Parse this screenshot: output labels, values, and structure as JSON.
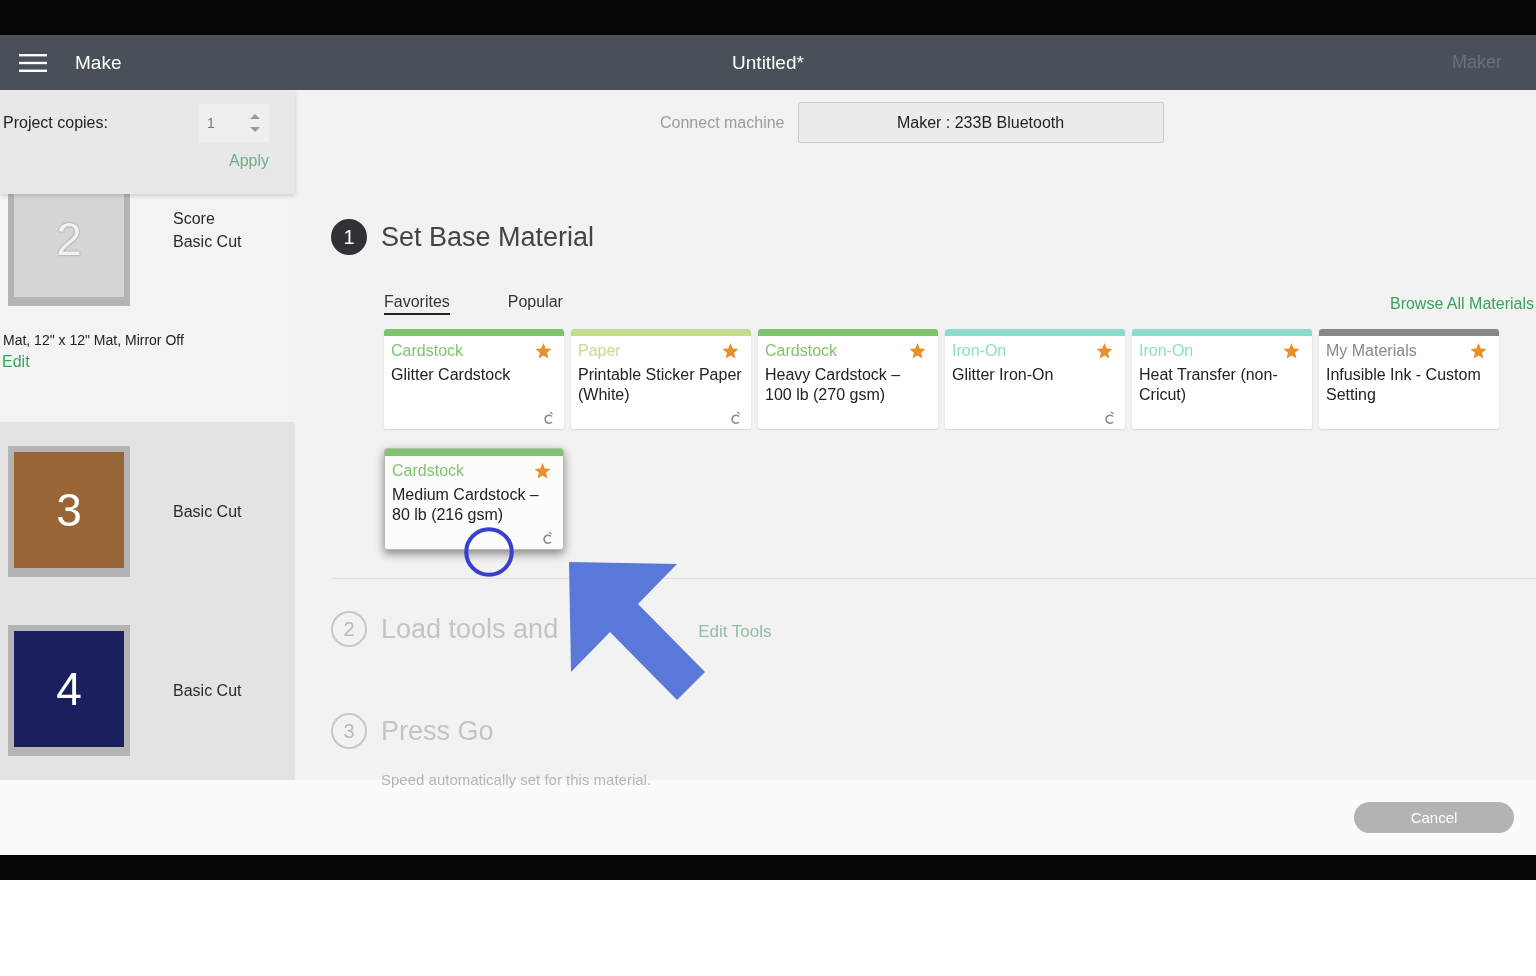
{
  "header": {
    "menu_label": "Make",
    "title": "Untitled*",
    "machine": "Maker"
  },
  "sidebar": {
    "copies": {
      "label": "Project copies:",
      "value": "1",
      "apply": "Apply"
    },
    "mats": [
      {
        "number": "2",
        "lines": [
          "Score",
          "Basic Cut"
        ],
        "selected": true,
        "kind": "gray",
        "info": "Mat, 12\" x 12\" Mat, Mirror Off",
        "edit": "Edit"
      },
      {
        "number": "3",
        "lines": [
          "Basic Cut"
        ],
        "selected": false,
        "kind": "brown"
      },
      {
        "number": "4",
        "lines": [
          "Basic Cut"
        ],
        "selected": false,
        "kind": "navy"
      }
    ]
  },
  "connect": {
    "label": "Connect machine",
    "button": "Maker : 233B Bluetooth"
  },
  "steps": [
    {
      "number": "1",
      "title": "Set Base Material",
      "active": true
    },
    {
      "number": "2",
      "title": "Load tools and",
      "active": false,
      "link": "Edit Tools"
    },
    {
      "number": "3",
      "title": "Press Go",
      "active": false,
      "note": "Speed automatically set for this material."
    }
  ],
  "material_tabs": [
    {
      "label": "Favorites",
      "selected": true
    },
    {
      "label": "Popular",
      "selected": false
    }
  ],
  "browse_link": "Browse All Materials",
  "materials": [
    {
      "category": "Cardstock",
      "name": "Glitter Cardstock",
      "color": "#7fc46c",
      "favorite": true,
      "cricut": true,
      "selected": false
    },
    {
      "category": "Paper",
      "name": "Printable Sticker Paper (White)",
      "color": "#c3dd8e",
      "favorite": true,
      "cricut": true,
      "selected": false
    },
    {
      "category": "Cardstock",
      "name": "Heavy Cardstock – 100 lb (270 gsm)",
      "color": "#7fc46c",
      "favorite": true,
      "cricut": false,
      "selected": false
    },
    {
      "category": "Iron-On",
      "name": "Glitter Iron-On",
      "color": "#8ddccb",
      "favorite": true,
      "cricut": true,
      "selected": false
    },
    {
      "category": "Iron-On",
      "name": "Heat Transfer (non-Cricut)",
      "color": "#8ddccb",
      "favorite": true,
      "cricut": false,
      "selected": false
    },
    {
      "category": "My Materials",
      "name": "Infusible Ink - Custom Setting",
      "color": "#878787",
      "favorite": true,
      "cricut": false,
      "selected": false
    },
    {
      "category": "Cardstock",
      "name": "Medium Cardstock – 80 lb (216 gsm)",
      "color": "#7fc46c",
      "favorite": true,
      "cricut": true,
      "selected": true
    }
  ],
  "footer": {
    "cancel": "Cancel"
  }
}
